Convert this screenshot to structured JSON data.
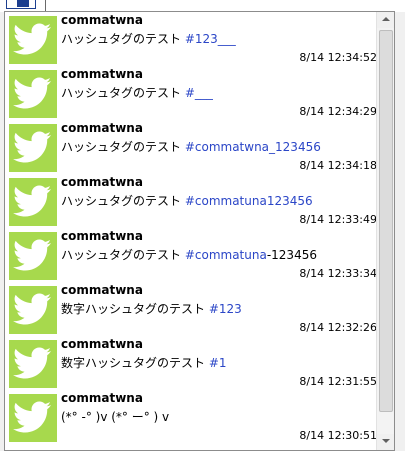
{
  "colors": {
    "avatar_bg": "#a7d94d",
    "hashtag": "#2b46c7",
    "bird": "#ffffff"
  },
  "tweets": [
    {
      "user": "commatwna",
      "text": "ハッシュタグのテスト ",
      "tag": "#123___",
      "suffix": "",
      "time": "8/14 12:34:52",
      "avatar_icon": "twitter-bird-icon"
    },
    {
      "user": "commatwna",
      "text": "ハッシュタグのテスト ",
      "tag": "#___",
      "suffix": "",
      "time": "8/14 12:34:29",
      "avatar_icon": "twitter-bird-icon"
    },
    {
      "user": "commatwna",
      "text": "ハッシュタグのテスト ",
      "tag": "#commatwna_123456",
      "suffix": "",
      "time": "8/14 12:34:18",
      "avatar_icon": "twitter-bird-icon"
    },
    {
      "user": "commatwna",
      "text": "ハッシュタグのテスト ",
      "tag": "#commatuna123456",
      "suffix": "",
      "time": "8/14 12:33:49",
      "avatar_icon": "twitter-bird-icon"
    },
    {
      "user": "commatwna",
      "text": "ハッシュタグのテスト ",
      "tag": "#commatuna",
      "suffix": "-123456",
      "time": "8/14 12:33:34",
      "avatar_icon": "twitter-bird-icon"
    },
    {
      "user": "commatwna",
      "text": "数字ハッシュタグのテスト ",
      "tag": "#123",
      "suffix": "",
      "time": "8/14 12:32:26",
      "avatar_icon": "twitter-bird-icon"
    },
    {
      "user": "commatwna",
      "text": "数字ハッシュタグのテスト ",
      "tag": "#1",
      "suffix": "",
      "time": "8/14 12:31:55",
      "avatar_icon": "twitter-bird-icon"
    },
    {
      "user": "commatwna",
      "text": "(*° -° )v (*° ー° ) v",
      "tag": "",
      "suffix": "",
      "time": "8/14 12:30:51",
      "avatar_icon": "twitter-bird-icon"
    }
  ]
}
